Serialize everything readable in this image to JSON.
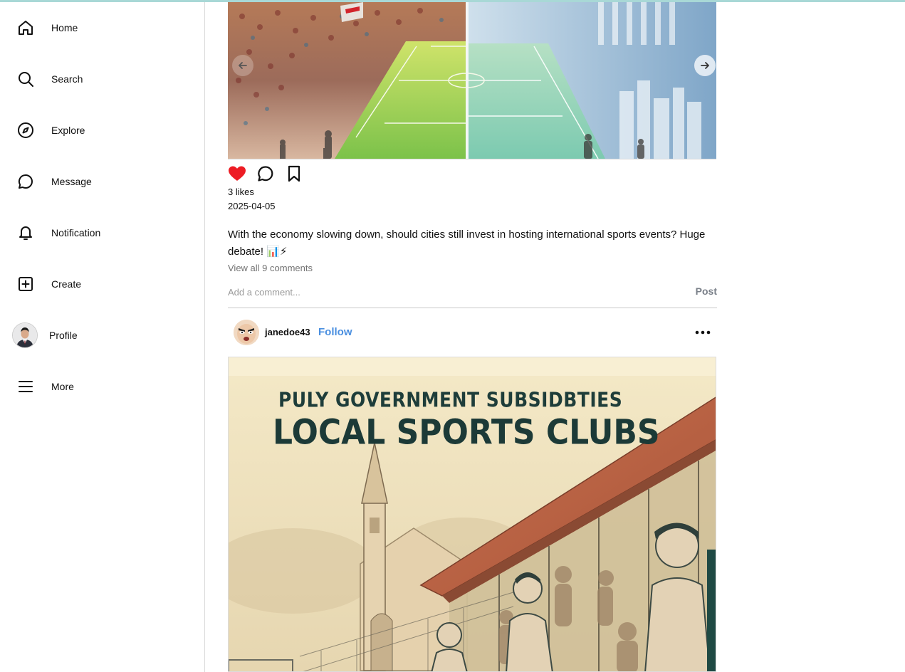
{
  "sidebar": {
    "items": [
      {
        "label": "Home",
        "icon": "home-icon"
      },
      {
        "label": "Search",
        "icon": "search-icon"
      },
      {
        "label": "Explore",
        "icon": "compass-icon"
      },
      {
        "label": "Message",
        "icon": "message-icon"
      },
      {
        "label": "Notification",
        "icon": "bell-icon"
      },
      {
        "label": "Create",
        "icon": "plus-square-icon"
      },
      {
        "label": "Profile",
        "icon": "avatar"
      },
      {
        "label": "More",
        "icon": "menu-icon"
      }
    ]
  },
  "post1": {
    "likes": "3 likes",
    "date": "2025-04-05",
    "caption": "With the economy slowing down, should cities still invest in hosting international sports events? Huge debate! 📊⚡",
    "view_comments": "View all 9 comments",
    "comment_placeholder": "Add a comment...",
    "post_label": "Post",
    "liked": true
  },
  "post2": {
    "author": "janedoe43",
    "follow_label": "Follow",
    "image_text_line1": "PULY GOVERNMENT SUBSIDBTIES",
    "image_text_line2": "LOCAL SPORTS CLUBS"
  },
  "colors": {
    "like_red": "#ed1c24",
    "follow_blue": "#4a8fe0",
    "border": "#dbdbdb"
  }
}
